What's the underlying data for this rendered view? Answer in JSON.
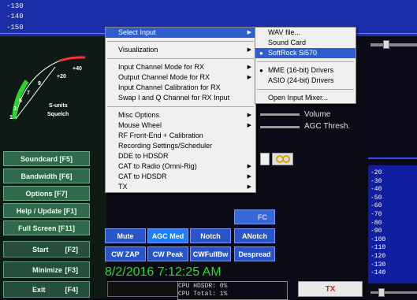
{
  "spectrum_scale": [
    "-130",
    "-140",
    "-150"
  ],
  "smeter": {
    "scale": [
      "+20",
      "+40",
      "9",
      "7",
      "5",
      "3",
      "1"
    ],
    "label_line1": "S-units",
    "label_line2": "Squelch"
  },
  "left_buttons": [
    {
      "label": "Soundcard  [F5]"
    },
    {
      "label": "Bandwidth  [F6]"
    },
    {
      "label": "Options  [F7]"
    },
    {
      "label": "Help / Update  [F1]"
    },
    {
      "label": "Full Screen  [F11]"
    }
  ],
  "left_buttons_lower": [
    {
      "label": "Start",
      "key": "[F2]"
    },
    {
      "label": "Minimize",
      "key": "[F3]"
    },
    {
      "label": "Exit",
      "key": "[F4]"
    }
  ],
  "dsp_rows": [
    [
      {
        "label": "Mute",
        "state": "normal"
      },
      {
        "label": "AGC Med",
        "state": "active"
      },
      {
        "label": "Notch",
        "state": "normal"
      },
      {
        "label": "ANotch",
        "state": "normal"
      }
    ],
    [
      {
        "label": "CW ZAP",
        "state": "normal"
      },
      {
        "label": "CW Peak",
        "state": "normal"
      },
      {
        "label": "CWFullBw",
        "state": "normal"
      },
      {
        "label": "Despread",
        "state": "normal"
      }
    ]
  ],
  "partial_label": "FC",
  "volume_label": "Volume",
  "agc_thresh_label": "AGC Thresh.",
  "clock": "8/2/2016 7:12:25 AM",
  "cpu": {
    "line1": "CPU HDSDR: 0%",
    "line2": "CPU Total: 1%"
  },
  "tx_label": "TX",
  "right_scale": [
    "-20",
    "-30",
    "-40",
    "-50",
    "-60",
    "-70",
    "-80",
    "-90",
    "-100",
    "-110",
    "-120",
    "-130",
    "-140"
  ],
  "main_menu": [
    {
      "label": "Select Input",
      "submenu": true,
      "selected": true
    },
    {
      "separator": true
    },
    {
      "label": "Visualization",
      "submenu": true
    },
    {
      "separator": true
    },
    {
      "label": "Input Channel Mode for RX",
      "submenu": true
    },
    {
      "label": "Output Channel Mode for RX",
      "submenu": true
    },
    {
      "label": "Input Channel Calibration for RX",
      "submenu": false
    },
    {
      "label": "Swap I and Q Channel for RX Input",
      "submenu": false
    },
    {
      "separator": true
    },
    {
      "label": "Misc Options",
      "submenu": true
    },
    {
      "label": "Mouse Wheel",
      "submenu": true
    },
    {
      "label": "RF Front-End + Calibration",
      "submenu": false
    },
    {
      "label": "Recording Settings/Scheduler",
      "submenu": false
    },
    {
      "label": "DDE to HDSDR",
      "submenu": false
    },
    {
      "label": "CAT to Radio (Omni-Rig)",
      "submenu": true
    },
    {
      "label": "CAT to HDSDR",
      "submenu": true
    },
    {
      "label": "TX",
      "submenu": true
    }
  ],
  "sub_menu": [
    {
      "label": "WAV file...",
      "bullet": false
    },
    {
      "label": "Sound Card",
      "bullet": false
    },
    {
      "label": "SoftRock Si570",
      "bullet": true,
      "selected": true
    },
    {
      "separator": true
    },
    {
      "label": "MME  (16-bit) Drivers",
      "bullet": true
    },
    {
      "label": "ASIO (24-bit) Drivers",
      "bullet": false
    },
    {
      "separator": true
    },
    {
      "label": "Open Input Mixer...",
      "bullet": false
    }
  ],
  "colors": {
    "spectrum_blue": "#1c2da8",
    "button_green": "#2f6a4c",
    "dsp_blue": "#2a55c8",
    "clock_green": "#22e022",
    "menu_highlight": "#2f5fcf"
  }
}
